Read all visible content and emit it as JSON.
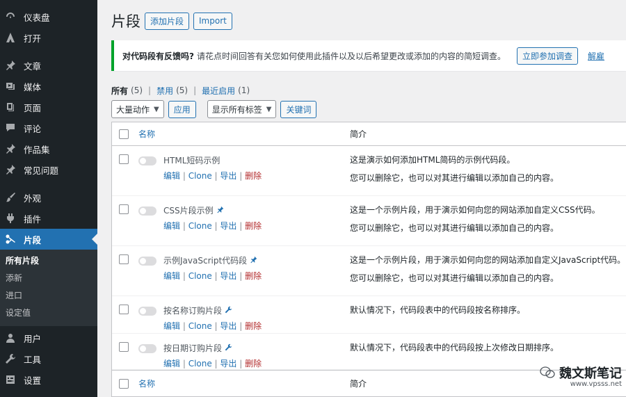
{
  "sidebar": {
    "items": [
      {
        "label": "仪表盘",
        "icon": "dashboard-icon"
      },
      {
        "label": "打开",
        "icon": "logo-icon"
      },
      {
        "label": "文章",
        "icon": "pin-icon"
      },
      {
        "label": "媒体",
        "icon": "media-icon"
      },
      {
        "label": "页面",
        "icon": "page-icon"
      },
      {
        "label": "评论",
        "icon": "comment-icon"
      },
      {
        "label": "作品集",
        "icon": "pin-icon"
      },
      {
        "label": "常见问题",
        "icon": "pin-icon"
      },
      {
        "label": "外观",
        "icon": "brush-icon"
      },
      {
        "label": "插件",
        "icon": "plugin-icon"
      },
      {
        "label": "片段",
        "icon": "scissors-icon"
      },
      {
        "label": "用户",
        "icon": "user-icon"
      },
      {
        "label": "工具",
        "icon": "wrench-icon"
      },
      {
        "label": "设置",
        "icon": "settings-icon"
      }
    ],
    "submenu": [
      "所有片段",
      "添新",
      "进口",
      "设定值"
    ]
  },
  "header": {
    "title": "片段",
    "add_label": "添加片段",
    "import_label": "Import"
  },
  "notice": {
    "strong": "对代码段有反馈吗?",
    "text": "请花点时间回答有关您如何使用此插件以及以后希望更改或添加的内容的简短调查。",
    "survey_label": "立即参加调查",
    "dismiss_label": "解雇"
  },
  "filters": [
    {
      "label": "所有",
      "count": "(5)"
    },
    {
      "label": "禁用",
      "count": "(5)"
    },
    {
      "label": "最近启用",
      "count": "(1)"
    }
  ],
  "toolbar": {
    "bulk_label": "大量动作",
    "apply_label": "应用",
    "tags_label": "显示所有标签",
    "keyword_label": "关键词"
  },
  "table": {
    "col_name": "名称",
    "col_desc": "简介",
    "actions": {
      "edit": "编辑",
      "clone": "Clone",
      "export": "导出",
      "delete": "删除"
    },
    "rows": [
      {
        "name": "HTML短码示例",
        "pin": false,
        "desc1": "这是演示如何添加HTML简码的示例代码段。",
        "desc2": "您可以删除它，也可以对其进行编辑以添加自己的内容。"
      },
      {
        "name": "CSS片段示例",
        "pin": true,
        "desc1": "这是一个示例片段，用于演示如何向您的网站添加自定义CSS代码。",
        "desc2": "您可以删除它，也可以对其进行编辑以添加自己的内容。"
      },
      {
        "name": "示例JavaScript代码段",
        "pin": true,
        "desc1": "这是一个示例片段，用于演示如何向您的网站添加自定义JavaScript代码。",
        "desc2": "您可以删除它，也可以对其进行编辑以添加自己的内容。"
      },
      {
        "name": "按名称订购片段",
        "pin": true,
        "desc1": "默认情况下，代码段表中的代码段按名称排序。",
        "desc2": ""
      },
      {
        "name": "按日期订购片段",
        "pin": true,
        "desc1": "默认情况下，代码段表中的代码段按上次修改日期排序。",
        "desc2": ""
      }
    ]
  },
  "watermark": {
    "text": "魏文斯笔记",
    "url": "www.vpsss.net"
  }
}
